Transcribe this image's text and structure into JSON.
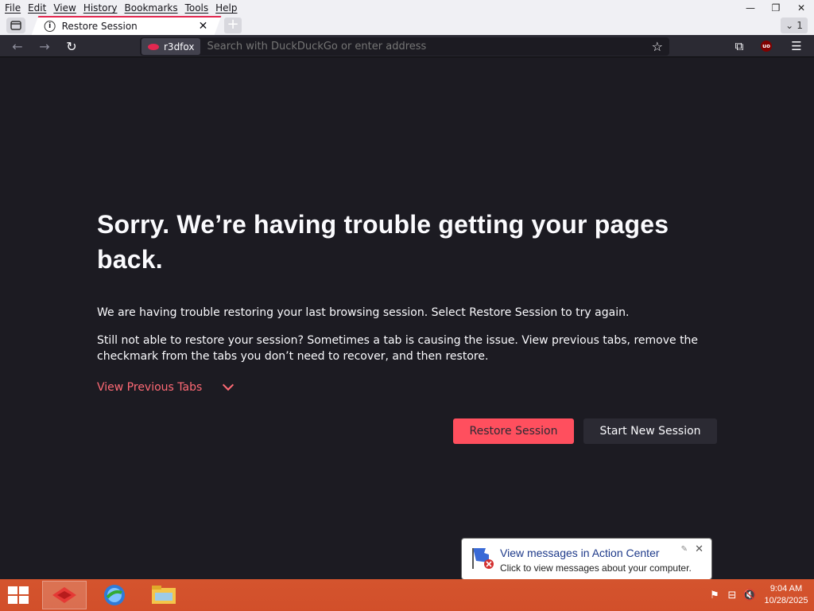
{
  "menu": [
    "File",
    "Edit",
    "View",
    "History",
    "Bookmarks",
    "Tools",
    "Help"
  ],
  "window_controls": {
    "minimize": "—",
    "maximize": "❐",
    "close": "✕"
  },
  "tab": {
    "title": "Restore Session",
    "close": "✕"
  },
  "all_tabs_count": "1",
  "identity_label": "r3dfox",
  "urlbar": {
    "placeholder": "Search with DuckDuckGo or enter address"
  },
  "error": {
    "title": "Sorry. We’re having trouble getting your pages back.",
    "p1": "We are having trouble restoring your last browsing session. Select Restore Session to try again.",
    "p2": "Still not able to restore your session? Sometimes a tab is causing the issue. View previous tabs, remove the checkmark from the tabs you don’t need to recover, and then restore.",
    "view_previous": "View Previous Tabs",
    "restore_button": "Restore Session",
    "new_session_button": "Start New Session"
  },
  "balloon": {
    "title": "View messages in Action Center",
    "text": "Click to view messages about your computer."
  },
  "clock": {
    "time": "9:04 AM",
    "date": "10/28/2025"
  },
  "colors": {
    "accent": "#ff4f5e",
    "taskbar": "#d4542e",
    "content_bg": "#1c1b22",
    "link": "#ff6a75"
  }
}
